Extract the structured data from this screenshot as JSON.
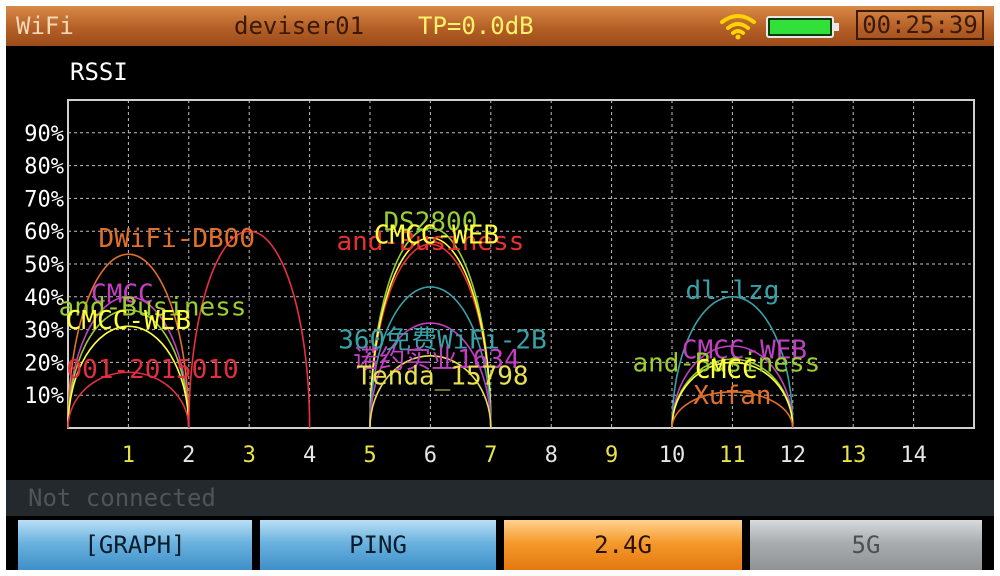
{
  "header": {
    "app_title": "WiFi",
    "ssid": "deviser01",
    "tx_power": "TP=0.0dB",
    "clock": "00:25:39",
    "wifi_icon": "wifi-signal-icon",
    "battery_icon": "battery-full-icon"
  },
  "graph": {
    "title": "RSSI"
  },
  "status": {
    "text": "Not connected"
  },
  "tabs": [
    {
      "label": "[GRAPH]",
      "state": "selected"
    },
    {
      "label": "PING",
      "state": "normal"
    },
    {
      "label": "2.4G",
      "state": "active-band"
    },
    {
      "label": "5G",
      "state": "disabled"
    }
  ],
  "colors": {
    "header_orange": "#c06a2c",
    "grid": "#bfbfbf",
    "odd_channel_label": "#e8e34a",
    "even_channel_label": "#e6e6e6",
    "tab_blue": "#5aa9dc",
    "tab_orange": "#f29022",
    "tab_gray": "#a9adb0"
  },
  "chart_data": {
    "type": "area",
    "title": "RSSI",
    "y_ticks": [
      "10%",
      "20%",
      "30%",
      "40%",
      "50%",
      "60%",
      "70%",
      "80%",
      "90%"
    ],
    "ylim": [
      0,
      100
    ],
    "x_ticks": [
      "1",
      "2",
      "3",
      "4",
      "5",
      "6",
      "7",
      "8",
      "9",
      "10",
      "11",
      "12",
      "13",
      "14"
    ],
    "xlim": [
      0,
      15
    ],
    "grid": true,
    "networks": [
      {
        "name": "DWiFi-DB00",
        "channel": 1,
        "rssi": 53,
        "color": "#e0702a",
        "label_x": 1.8,
        "label_y": 58
      },
      {
        "name": "CMCC",
        "channel": 1,
        "rssi": 40,
        "color": "#c040c0",
        "label_x": 0.9,
        "label_y": 41
      },
      {
        "name": "and-Business",
        "channel": 1,
        "rssi": 36,
        "color": "#9acd32",
        "label_x": 1.4,
        "label_y": 37
      },
      {
        "name": "CMCC-WEB",
        "channel": 1,
        "rssi": 31,
        "color": "#ffff40",
        "label_x": 1.0,
        "label_y": 33
      },
      {
        "name": "001-2015010",
        "channel": 1,
        "rssi": 17,
        "color": "#e03040",
        "label_x": 1.4,
        "label_y": 18
      },
      {
        "name": "",
        "channel": 3,
        "rssi": 60,
        "color": "#e83040",
        "label_x": null,
        "label_y": null
      },
      {
        "name": "and-Business",
        "channel": 6,
        "rssi": 56,
        "color": "#e83030",
        "label_x": 6.0,
        "label_y": 57
      },
      {
        "name": "DS2800",
        "channel": 6,
        "rssi": 61,
        "color": "#9acd32",
        "label_x": 6.0,
        "label_y": 63
      },
      {
        "name": "CMCC-WEB",
        "channel": 6,
        "rssi": 58,
        "color": "#ffff40",
        "label_x": 6.1,
        "label_y": 59
      },
      {
        "name": "360免费WiFi-2B",
        "channel": 6,
        "rssi": 43,
        "color": "#3aa0a8",
        "label_x": 6.2,
        "label_y": 27
      },
      {
        "name": "诺约实业1634",
        "channel": 6,
        "rssi": 32,
        "color": "#c040c0",
        "label_x": 6.1,
        "label_y": 21
      },
      {
        "name": "Tenda_15798",
        "channel": 6,
        "rssi": 22,
        "color": "#e8e050",
        "label_x": 6.2,
        "label_y": 16
      },
      {
        "name": "dl-lzg",
        "channel": 11,
        "rssi": 40,
        "color": "#3aa0a8",
        "label_x": 11.0,
        "label_y": 42
      },
      {
        "name": "CMCC-WEB",
        "channel": 11,
        "rssi": 25,
        "color": "#c040c0",
        "label_x": 11.2,
        "label_y": 24
      },
      {
        "name": "and-Business",
        "channel": 11,
        "rssi": 21,
        "color": "#9acd32",
        "label_x": 10.9,
        "label_y": 20
      },
      {
        "name": "CMCC",
        "channel": 11,
        "rssi": 20,
        "color": "#ffff40",
        "label_x": 10.9,
        "label_y": 18
      },
      {
        "name": "Xufan",
        "channel": 11,
        "rssi": 11,
        "color": "#e0702a",
        "label_x": 11.0,
        "label_y": 10
      }
    ]
  }
}
